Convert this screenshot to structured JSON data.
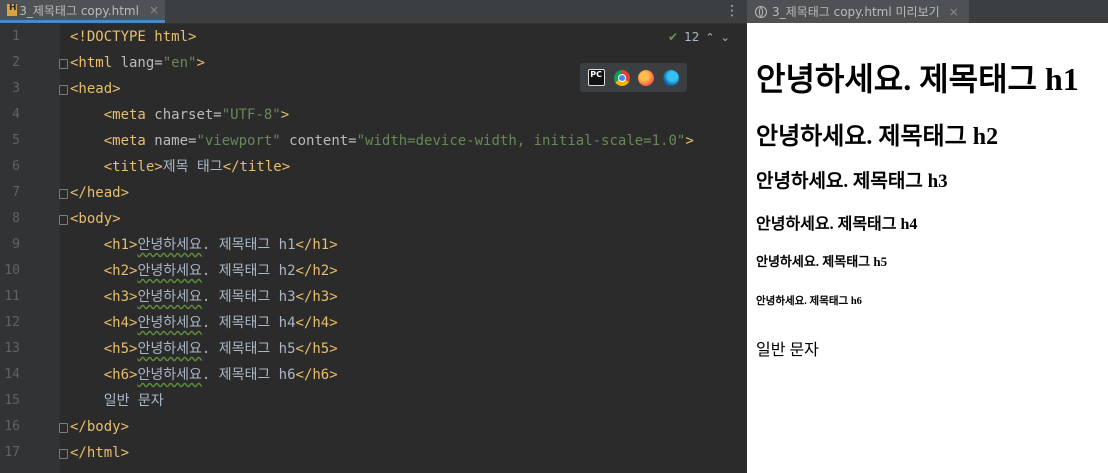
{
  "editor": {
    "tab_label": "3_제목태그 copy.html",
    "menu_icon": "⋮",
    "inspection_count": "12",
    "line_numbers": [
      "1",
      "2",
      "3",
      "4",
      "5",
      "6",
      "7",
      "8",
      "9",
      "10",
      "11",
      "12",
      "13",
      "14",
      "15",
      "16",
      "17"
    ],
    "lines": [
      [
        [
          "tg",
          "<!DOCTYPE html>"
        ]
      ],
      [
        [
          "tg",
          "<html "
        ],
        [
          "at",
          "lang="
        ],
        [
          "st",
          "\"en\""
        ],
        [
          "tg",
          ">"
        ]
      ],
      [
        [
          "tg",
          "<head>"
        ]
      ],
      [
        [
          "tx",
          "    "
        ],
        [
          "tg",
          "<meta "
        ],
        [
          "at",
          "charset="
        ],
        [
          "st",
          "\"UTF-8\""
        ],
        [
          "tg",
          ">"
        ]
      ],
      [
        [
          "tx",
          "    "
        ],
        [
          "tg",
          "<meta "
        ],
        [
          "at",
          "name="
        ],
        [
          "st",
          "\"viewport\""
        ],
        [
          "at",
          " content="
        ],
        [
          "st",
          "\"width=device-width, initial-scale=1.0\""
        ],
        [
          "tg",
          ">"
        ]
      ],
      [
        [
          "tx",
          "    "
        ],
        [
          "tg",
          "<title>"
        ],
        [
          "tx",
          "제목 태그"
        ],
        [
          "tg",
          "</title>"
        ]
      ],
      [
        [
          "tg",
          "</head>"
        ]
      ],
      [
        [
          "tg",
          "<body>"
        ]
      ],
      [
        [
          "tx",
          "    "
        ],
        [
          "tg",
          "<h1>"
        ],
        [
          "sq",
          "안녕하세요"
        ],
        [
          "tx",
          ". 제목태그 h1"
        ],
        [
          "tg",
          "</h1>"
        ]
      ],
      [
        [
          "tx",
          "    "
        ],
        [
          "tg",
          "<h2>"
        ],
        [
          "sq",
          "안녕하세요"
        ],
        [
          "tx",
          ". 제목태그 h2"
        ],
        [
          "tg",
          "</h2>"
        ]
      ],
      [
        [
          "tx",
          "    "
        ],
        [
          "tg",
          "<h3>"
        ],
        [
          "sq",
          "안녕하세요"
        ],
        [
          "tx",
          ". 제목태그 h3"
        ],
        [
          "tg",
          "</h3>"
        ]
      ],
      [
        [
          "tx",
          "    "
        ],
        [
          "tg",
          "<h4>"
        ],
        [
          "sq",
          "안녕하세요"
        ],
        [
          "tx",
          ". 제목태그 h4"
        ],
        [
          "tg",
          "</h4>"
        ]
      ],
      [
        [
          "tx",
          "    "
        ],
        [
          "tg",
          "<h5>"
        ],
        [
          "sq",
          "안녕하세요"
        ],
        [
          "tx",
          ". 제목태그 h5"
        ],
        [
          "tg",
          "</h5>"
        ]
      ],
      [
        [
          "tx",
          "    "
        ],
        [
          "tg",
          "<h6>"
        ],
        [
          "sq",
          "안녕하세요"
        ],
        [
          "tx",
          ". 제목태그 h6"
        ],
        [
          "tg",
          "</h6>"
        ]
      ],
      [
        [
          "tx",
          "    일반 문자"
        ]
      ],
      [
        [
          "tg",
          "</body>"
        ]
      ],
      [
        [
          "tg",
          "</html>"
        ]
      ]
    ],
    "browser_icons": [
      "pycharm-icon",
      "chrome-icon",
      "firefox-icon",
      "edge-icon"
    ]
  },
  "preview": {
    "tab_label": "3_제목태그 copy.html 미리보기",
    "h1": "안녕하세요. 제목태그 h1",
    "h2": "안녕하세요. 제목태그 h2",
    "h3": "안녕하세요. 제목태그 h3",
    "h4": "안녕하세요. 제목태그 h4",
    "h5": "안녕하세요. 제목태그 h5",
    "h6": "안녕하세요. 제목태그 h6",
    "paragraph": "일반 문자"
  },
  "close_glyph": "×",
  "colors": {
    "editor_bg": "#2b2b2b",
    "tag": "#e8bf6a",
    "string": "#6a8759",
    "attribute": "#bababa",
    "text": "#a9b7c6",
    "tab_underline": "#4a88c7"
  }
}
